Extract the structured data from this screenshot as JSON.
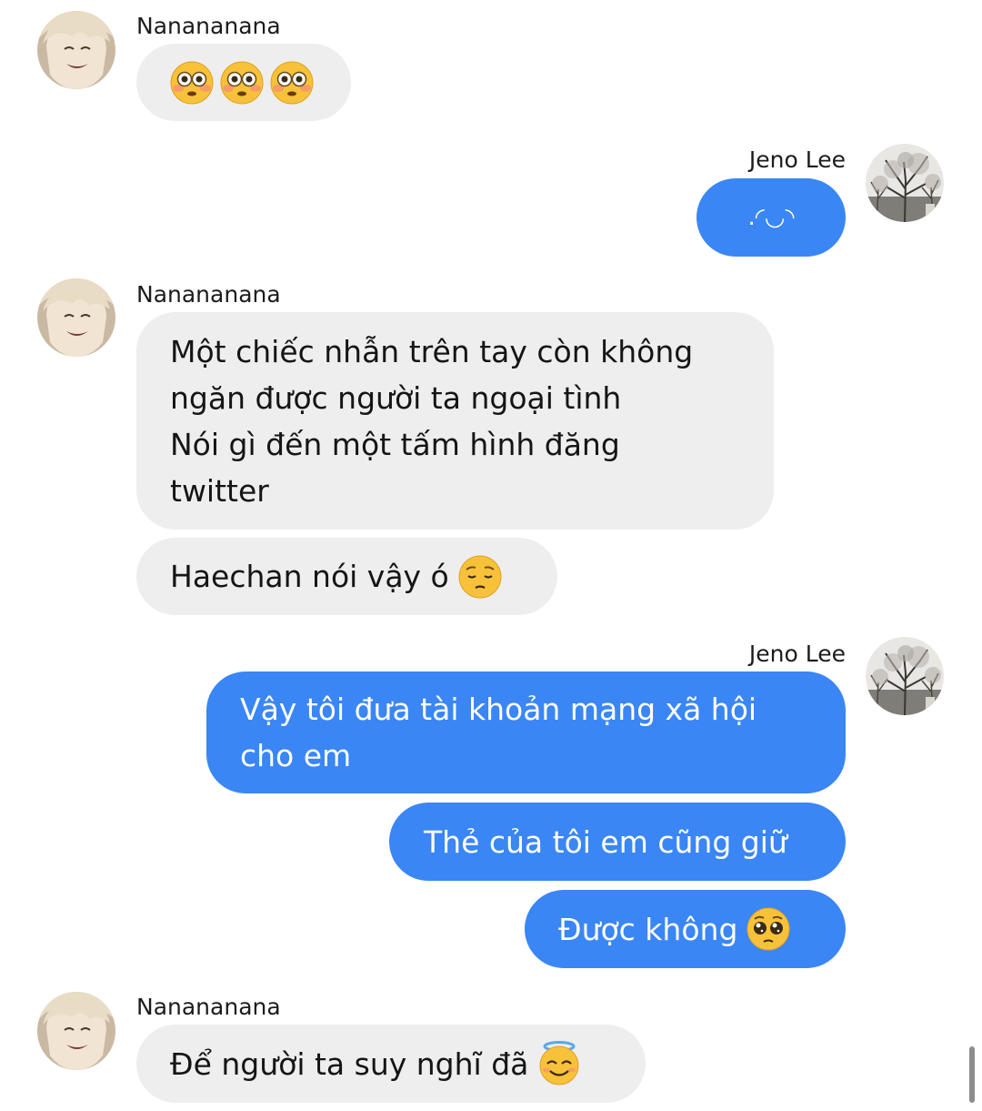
{
  "messages": [
    {
      "sender": "Nanananana",
      "direction": "incoming",
      "bubbles": [
        {
          "text": "",
          "emojis": [
            "flushed-face-emoji",
            "flushed-face-emoji",
            "flushed-face-emoji"
          ]
        }
      ]
    },
    {
      "sender": "Jeno Lee",
      "direction": "outgoing",
      "bubbles": [
        {
          "text": ".◜◡◝"
        }
      ]
    },
    {
      "sender": "Nanananana",
      "direction": "incoming",
      "bubbles": [
        {
          "text": "Một chiếc nhẫn trên tay còn không\nngăn được người ta ngoại tình\nNói gì đến một tấm hình đăng\ntwitter"
        },
        {
          "text": "Haechan nói vậy ó",
          "emojis": [
            "pensive-face-emoji"
          ]
        }
      ]
    },
    {
      "sender": "Jeno Lee",
      "direction": "outgoing",
      "bubbles": [
        {
          "text": "Vậy tôi đưa tài khoản   mạng xã hội\ncho em"
        },
        {
          "text": "Thẻ của tôi em cũng giữ"
        },
        {
          "text": "Được không",
          "emojis": [
            "pleading-face-emoji"
          ]
        }
      ]
    },
    {
      "sender": "Nanananana",
      "direction": "incoming",
      "bubbles": [
        {
          "text": "Để người ta suy nghĩ đã",
          "emojis": [
            "smiling-face-with-halo-emoji"
          ]
        }
      ]
    }
  ],
  "colors": {
    "incoming_bubble": "#eeeeef",
    "outgoing_bubble": "#3a86f4",
    "outgoing_text": "#ffffff",
    "incoming_text": "#151515"
  }
}
